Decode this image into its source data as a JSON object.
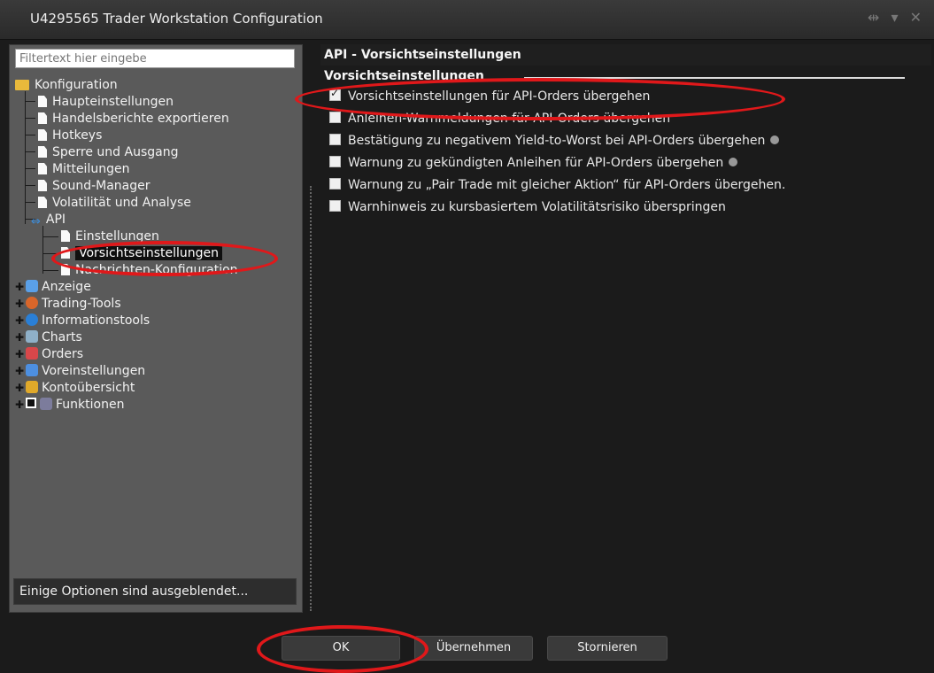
{
  "window": {
    "title": "U4295565 Trader Workstation Configuration"
  },
  "sidebar": {
    "filter_placeholder": "Filtertext hier eingebe",
    "root": "Konfiguration",
    "items": [
      {
        "label": "Haupteinstellungen"
      },
      {
        "label": "Handelsberichte exportieren"
      },
      {
        "label": "Hotkeys"
      },
      {
        "label": "Sperre und Ausgang"
      },
      {
        "label": "Mitteilungen"
      },
      {
        "label": "Sound-Manager"
      },
      {
        "label": "Volatilität und Analyse"
      },
      {
        "label": "API"
      }
    ],
    "api_children": [
      {
        "label": "Einstellungen"
      },
      {
        "label": "Vorsichtseinstellungen"
      },
      {
        "label": "Nachrichten-Konfiguration"
      }
    ],
    "categories": [
      {
        "label": "Anzeige"
      },
      {
        "label": "Trading-Tools"
      },
      {
        "label": "Informationstools"
      },
      {
        "label": "Charts"
      },
      {
        "label": "Orders"
      },
      {
        "label": "Voreinstellungen"
      },
      {
        "label": "Kontoübersicht"
      },
      {
        "label": "Funktionen"
      }
    ],
    "hidden_options": "Einige Optionen sind ausgeblendet..."
  },
  "main": {
    "header": "API - Vorsichtseinstellungen",
    "group_title": "Vorsichtseinstellungen",
    "options": [
      {
        "label": "Vorsichtseinstellungen für API-Orders übergehen",
        "checked": true
      },
      {
        "label": "Anleihen-Warnmeldungen für API-Orders übergehen",
        "checked": false
      },
      {
        "label": "Bestätigung zu negativem Yield-to-Worst bei API-Orders übergehen",
        "checked": false
      },
      {
        "label": "Warnung zu gekündigten Anleihen für API-Orders übergehen",
        "checked": false
      },
      {
        "label": "Warnung zu „Pair Trade mit gleicher Aktion“ für API-Orders übergehen.",
        "checked": false
      },
      {
        "label": "Warnhinweis zu kursbasiertem Volatilitätsrisiko überspringen",
        "checked": false
      }
    ]
  },
  "buttons": {
    "ok": "OK",
    "apply": "Übernehmen",
    "cancel": "Stornieren"
  },
  "colors": {
    "annotation": "#e0181a",
    "background": "#1b1b1b",
    "sidebar": "#5a5a5a"
  }
}
